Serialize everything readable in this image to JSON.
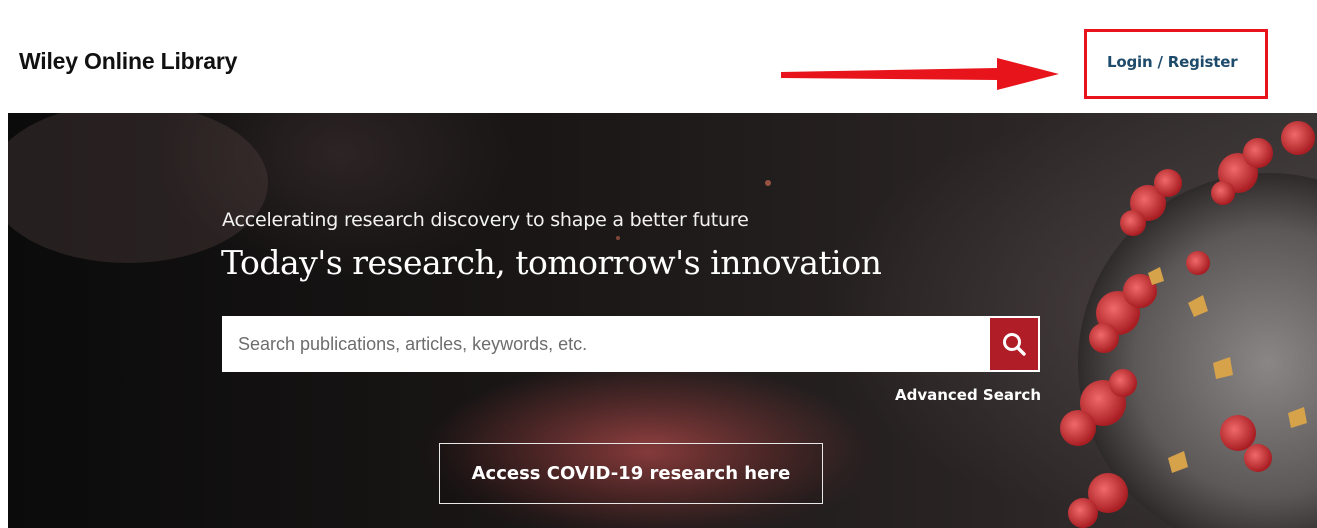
{
  "header": {
    "logo_text": "Wiley Online Library",
    "login_label": "Login / Register"
  },
  "hero": {
    "tagline": "Accelerating research discovery to shape a better future",
    "headline": "Today's research, tomorrow's innovation",
    "search": {
      "placeholder": "Search publications, articles, keywords, etc.",
      "value": ""
    },
    "advanced_search_label": "Advanced Search",
    "covid_button_label": "Access COVID-19 research here"
  },
  "colors": {
    "annotation_red": "#e8141b",
    "login_text": "#1e4a6b",
    "search_button": "#b11d27"
  },
  "icons": {
    "search": "magnifier-icon",
    "annotation": "arrow-right-icon"
  }
}
